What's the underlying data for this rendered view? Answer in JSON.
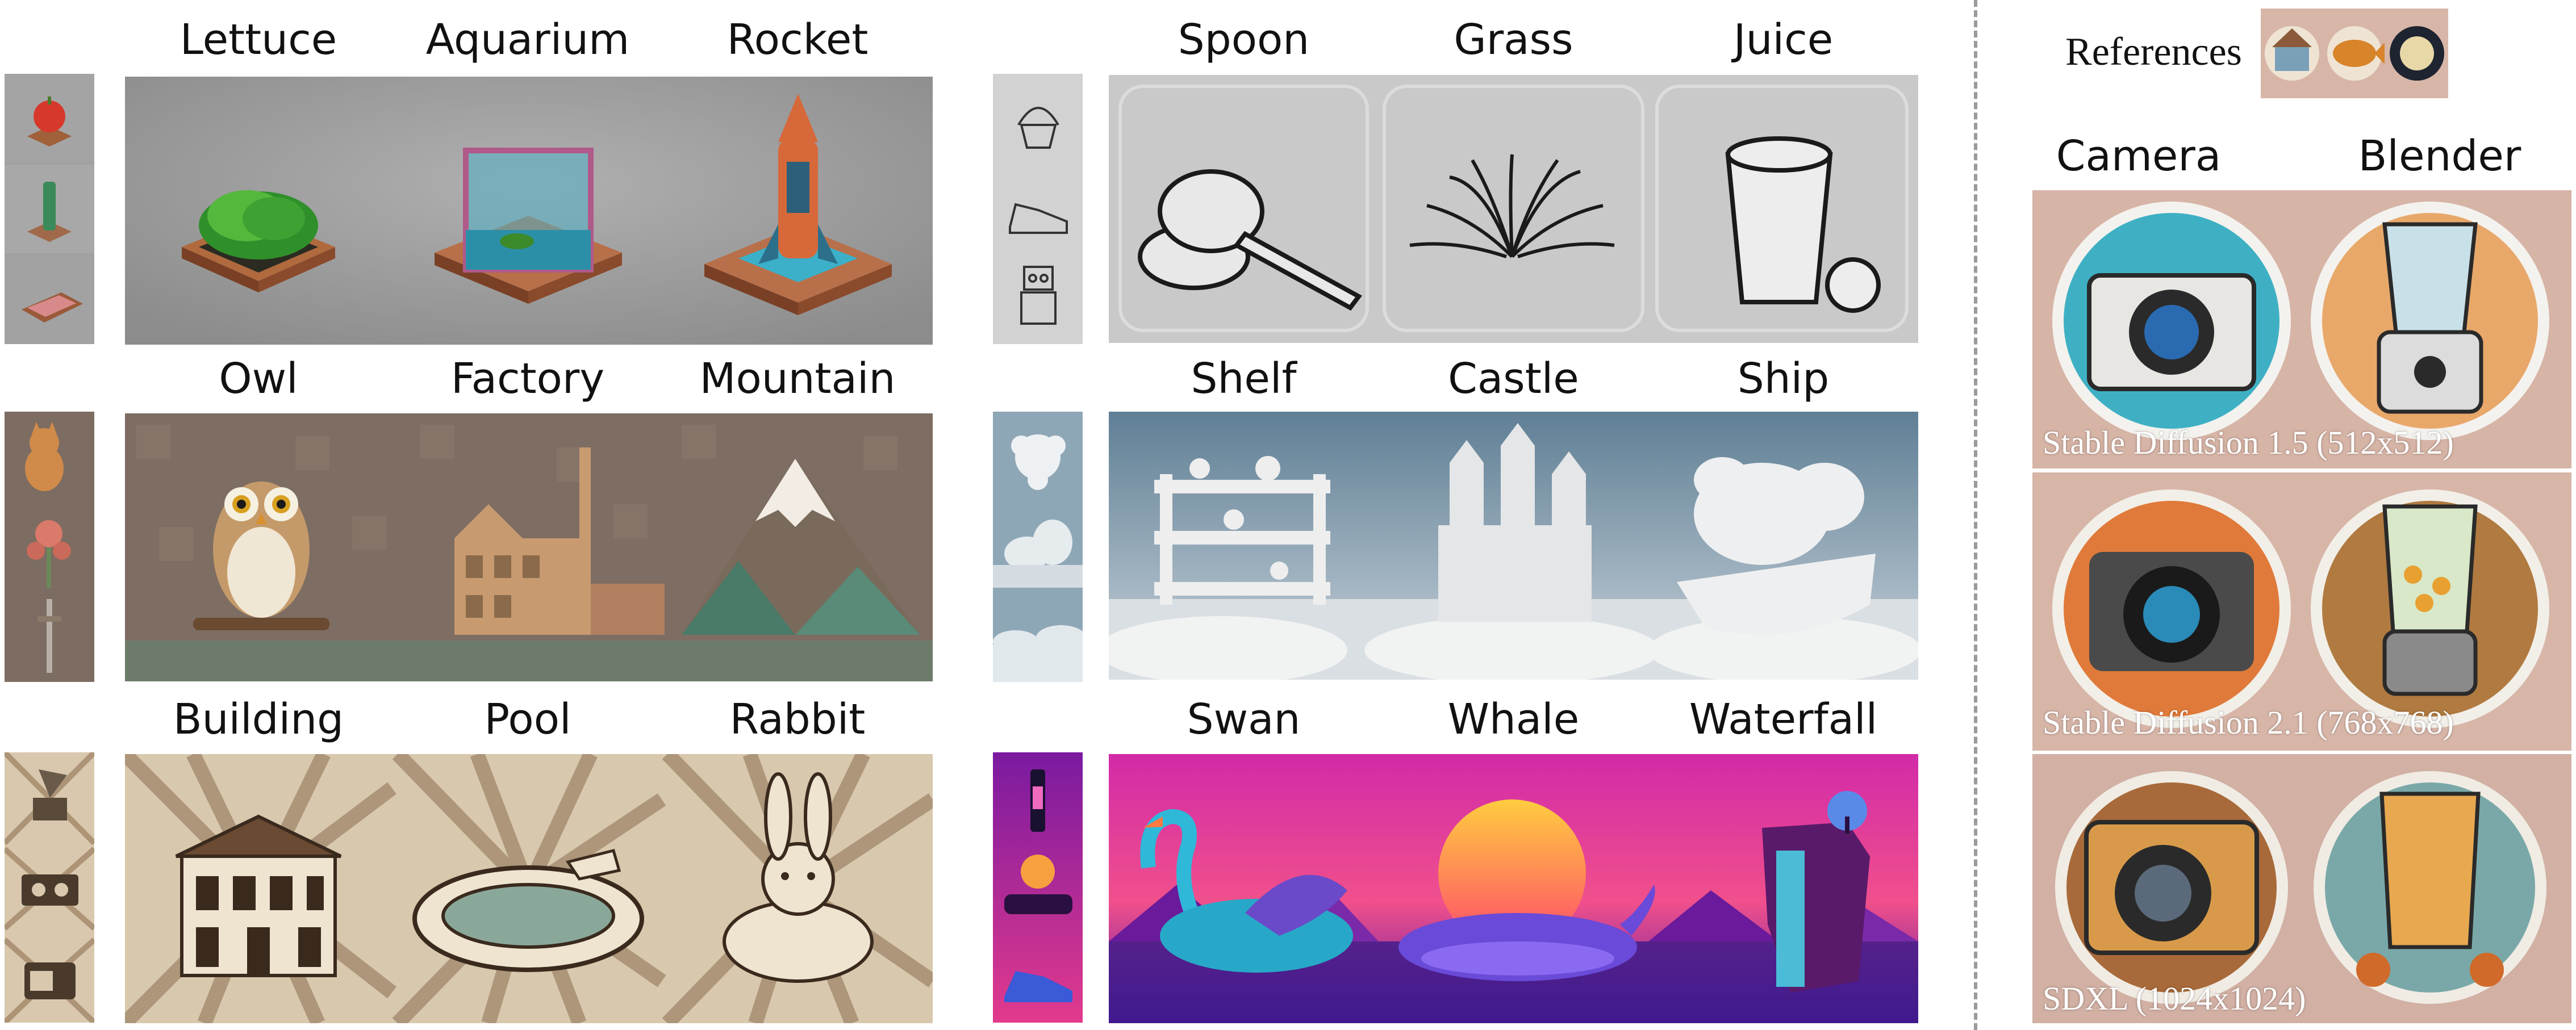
{
  "rows_left": [
    {
      "labels": [
        "Lettuce",
        "Aquarium",
        "Rocket"
      ],
      "reference_images": [
        "apple-figure",
        "bottle-figure",
        "bed-figure"
      ]
    },
    {
      "labels": [
        "Owl",
        "Factory",
        "Mountain"
      ],
      "reference_images": [
        "cat-figure",
        "flower-figure",
        "sword-figure"
      ]
    },
    {
      "labels": [
        "Building",
        "Pool",
        "Rabbit"
      ],
      "reference_images": [
        "gramophone-figure",
        "cassette-player-figure",
        "radio-figure"
      ]
    }
  ],
  "rows_middle": [
    {
      "labels": [
        "Spoon",
        "Grass",
        "Juice"
      ],
      "reference_images": [
        "cupcake-sketch",
        "sneaker-sketch",
        "robot-sketch"
      ]
    },
    {
      "labels": [
        "Shelf",
        "Castle",
        "Ship"
      ],
      "reference_images": [
        "snowflake-cloud",
        "wave-cloud",
        "cloud-layer"
      ]
    },
    {
      "labels": [
        "Swan",
        "Whale",
        "Waterfall"
      ],
      "reference_images": [
        "neon-bottle",
        "neon-car",
        "neon-shoe"
      ]
    }
  ],
  "references": {
    "title": "References",
    "images": [
      "house-sticker",
      "fish-sticker",
      "moon-sticker"
    ],
    "labels": [
      "Camera",
      "Blender"
    ],
    "models": [
      "Stable Diffusion 1.5 (512x512)",
      "Stable Diffusion 2.1 (768x768)",
      "SDXL (1024x1024)"
    ]
  },
  "colors": {
    "iso_bg": "#9a9a9a",
    "sketch_bg": "#cfcfcf",
    "mosaic_bg": "#7e6d62",
    "cloud_bg": "#8fa8b8",
    "retro_bg": "#d8c8ad",
    "neon_bg": "#c0269c",
    "sticker_bg": "#d7b6a8"
  }
}
